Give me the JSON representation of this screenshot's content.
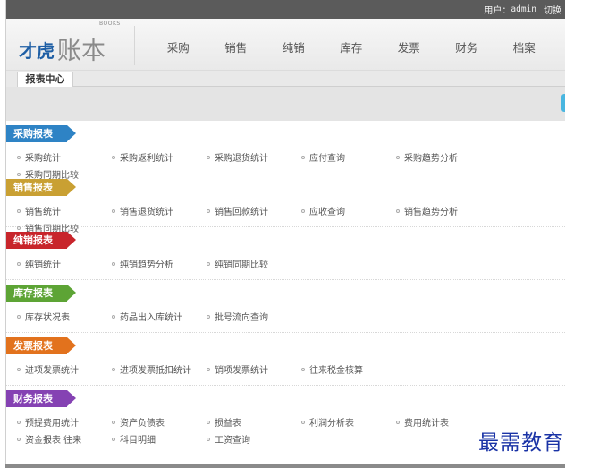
{
  "topbar": {
    "user_label": "用户：",
    "username": "admin",
    "switch_label": "切换"
  },
  "logo": {
    "part_a": "才虎",
    "part_b": "账本",
    "tag": "BOOKS"
  },
  "nav": [
    "采购",
    "销售",
    "纯销",
    "库存",
    "发票",
    "财务",
    "档案"
  ],
  "tab": {
    "label": "报表中心"
  },
  "colors": {
    "purchase": "#2e83c5",
    "sales": "#c9a033",
    "pure": "#c8252b",
    "stock": "#5da435",
    "invoice": "#e2721d",
    "finance": "#8542b3",
    "watermark": "#1a33a6"
  },
  "sections": [
    {
      "title": "采购报表",
      "color": "#2e83c5",
      "items": [
        "采购统计",
        "采购返利统计",
        "采购退货统计",
        "应付查询",
        "采购趋势分析",
        "采购同期比较"
      ]
    },
    {
      "title": "销售报表",
      "color": "#c9a033",
      "items": [
        "销售统计",
        "销售退货统计",
        "销售回款统计",
        "应收查询",
        "销售趋势分析",
        "销售同期比较"
      ]
    },
    {
      "title": "纯销报表",
      "color": "#c8252b",
      "items": [
        "纯销统计",
        "纯销趋势分析",
        "纯销同期比较"
      ]
    },
    {
      "title": "库存报表",
      "color": "#5da435",
      "items": [
        "库存状况表",
        "药品出入库统计",
        "批号流向查询"
      ]
    },
    {
      "title": "发票报表",
      "color": "#e2721d",
      "items": [
        "进项发票统计",
        "进项发票抵扣统计",
        "销项发票统计",
        "往来税金核算"
      ]
    },
    {
      "title": "财务报表",
      "color": "#8542b3",
      "items": [
        "预提费用统计",
        "资产负债表",
        "损益表",
        "利润分析表",
        "费用统计表",
        "资金报表 往来",
        "科目明细",
        "工资查询"
      ]
    }
  ],
  "watermark": "最需教育"
}
